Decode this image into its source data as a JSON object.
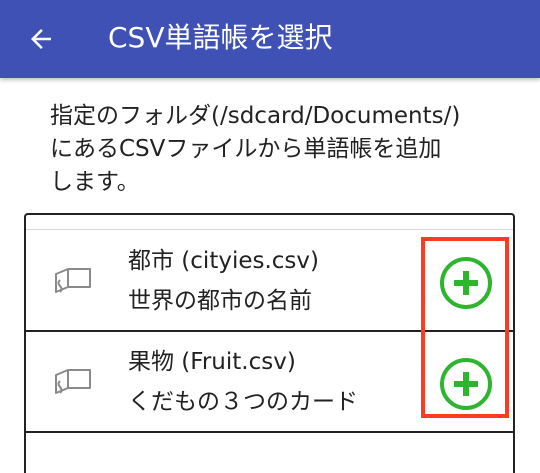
{
  "header": {
    "title": "CSV単語帳を選択",
    "background_color": "#3f51b5",
    "back_icon": "arrow-left-icon"
  },
  "description": {
    "line1": "指定のフォルダ(/sdcard/Documents/)",
    "line2": "にあるCSVファイルから単語帳を追加",
    "line3": "します。"
  },
  "items": [
    {
      "title": "都市 (cityies.csv)",
      "subtitle": "世界の都市の名前",
      "icon": "book-icon",
      "action_icon": "add-circle-icon"
    },
    {
      "title": "果物 (Fruit.csv)",
      "subtitle": "くだもの３つのカード",
      "icon": "book-icon",
      "action_icon": "add-circle-icon"
    }
  ],
  "colors": {
    "accent_add": "#2db52d",
    "highlight": "#ff3b1f"
  }
}
